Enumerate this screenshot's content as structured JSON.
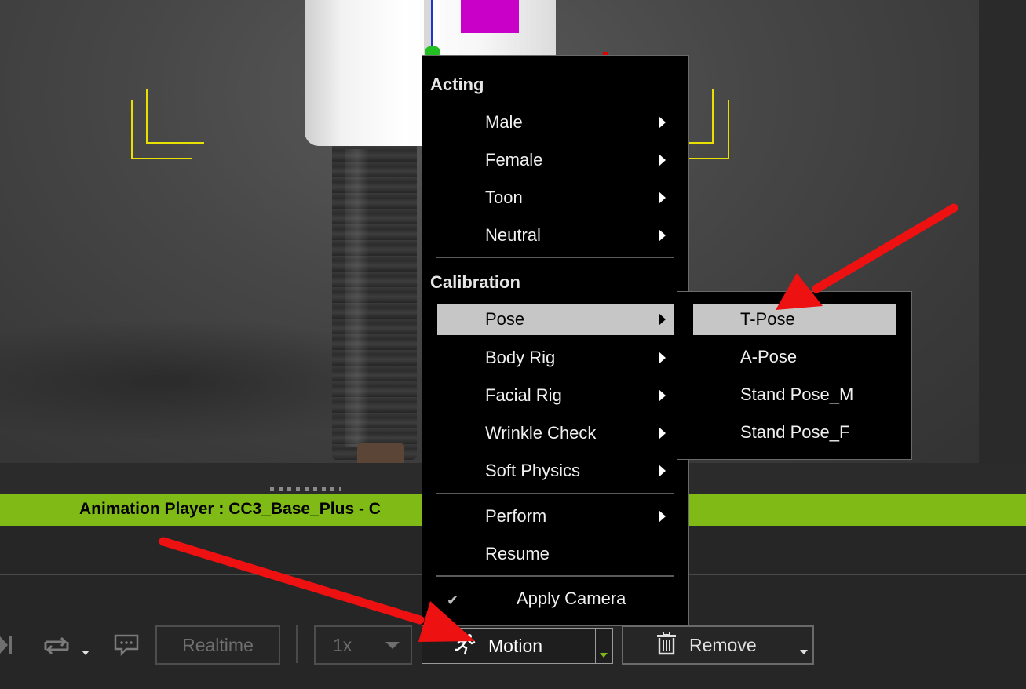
{
  "animation_player": {
    "title": "Animation Player : CC3_Base_Plus - C"
  },
  "context_menu": {
    "sections": [
      {
        "header": "Acting",
        "items": [
          {
            "label": "Male",
            "submenu": true
          },
          {
            "label": "Female",
            "submenu": true
          },
          {
            "label": "Toon",
            "submenu": true
          },
          {
            "label": "Neutral",
            "submenu": true
          }
        ]
      },
      {
        "header": "Calibration",
        "items": [
          {
            "label": "Pose",
            "submenu": true,
            "highlighted": true
          },
          {
            "label": "Body Rig",
            "submenu": true
          },
          {
            "label": "Facial Rig",
            "submenu": true
          },
          {
            "label": "Wrinkle Check",
            "submenu": true
          },
          {
            "label": "Soft Physics",
            "submenu": true
          }
        ]
      },
      {
        "header": "",
        "items": [
          {
            "label": "Perform",
            "submenu": true
          },
          {
            "label": "Resume",
            "submenu": false
          }
        ]
      }
    ],
    "apply_camera": {
      "label": "Apply Camera",
      "checked": true
    }
  },
  "pose_submenu": {
    "items": [
      {
        "label": "T-Pose",
        "highlighted": true
      },
      {
        "label": "A-Pose"
      },
      {
        "label": "Stand Pose_M"
      },
      {
        "label": "Stand Pose_F"
      }
    ]
  },
  "toolbar": {
    "realtime_label": "Realtime",
    "speed_value": "1x",
    "motion_label": "Motion",
    "remove_label": "Remove"
  },
  "icons": {
    "play": "play-icon",
    "loop": "loop-icon",
    "comment": "comment-icon",
    "motion": "running-figure-icon",
    "remove": "trash-icon",
    "check": "checkmark-icon"
  },
  "colors": {
    "accent_green": "#7fba16",
    "menu_highlight": "#c6c6c6",
    "annotation_red": "#ee1111",
    "bracket_yellow": "#e8e000"
  }
}
